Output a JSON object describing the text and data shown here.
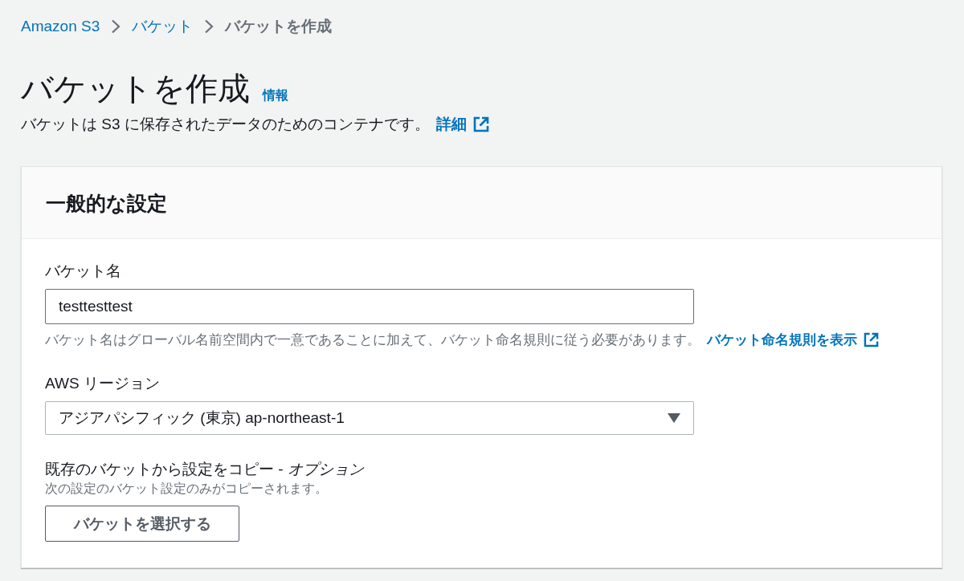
{
  "breadcrumb": [
    {
      "label": "Amazon S3",
      "kind": "link"
    },
    {
      "label": "バケット",
      "kind": "link"
    },
    {
      "label": "バケットを作成",
      "kind": "current"
    }
  ],
  "page": {
    "title": "バケットを作成",
    "info_link": "情報",
    "description": "バケットは S3 に保存されたデータのためのコンテナです。",
    "description_link": "詳細"
  },
  "panel": {
    "title": "一般的な設定",
    "fields": [
      {
        "kind": "text",
        "label": "バケット名",
        "value": "testtesttest",
        "hint": "バケット名はグローバル名前空間内で一意であることに加えて、バケット命名規則に従う必要があります。",
        "hint_link": "バケット命名規則を表示"
      },
      {
        "kind": "select",
        "label": "AWS リージョン",
        "value": "アジアパシフィック (東京) ap-northeast-1"
      },
      {
        "kind": "button",
        "label": "既存のバケットから設定をコピー - *オプション*",
        "hint": "次の設定のバケット設定のみがコピーされます。",
        "button": "バケットを選択する"
      }
    ]
  }
}
